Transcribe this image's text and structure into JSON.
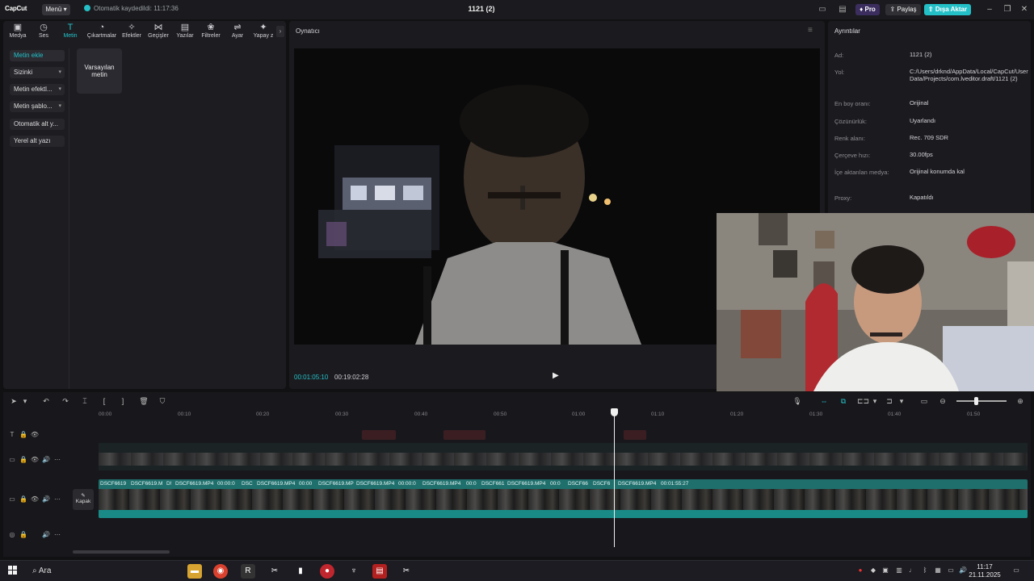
{
  "titlebar": {
    "logo": "CapCut",
    "menu_label": "Menü",
    "autosave": "Otomatik kaydedildi: 11:17:36",
    "title": "1121 (2)",
    "pro_label": "Pro",
    "share_label": "Paylaş",
    "export_label": "Dışa Aktar"
  },
  "toolbar": [
    {
      "label": "Medya",
      "icon": "media-icon"
    },
    {
      "label": "Ses",
      "icon": "audio-icon"
    },
    {
      "label": "Metin",
      "icon": "text-icon"
    },
    {
      "label": "Çıkartmalar",
      "icon": "sticker-icon"
    },
    {
      "label": "Efektler",
      "icon": "effects-icon"
    },
    {
      "label": "Geçişler",
      "icon": "transitions-icon"
    },
    {
      "label": "Yazılar",
      "icon": "captions-icon"
    },
    {
      "label": "Filtreler",
      "icon": "filters-icon"
    },
    {
      "label": "Ayar",
      "icon": "adjust-icon"
    },
    {
      "label": "Yapay z",
      "icon": "ai-icon"
    }
  ],
  "text_nav": {
    "items": [
      {
        "label": "Metin ekle"
      },
      {
        "label": "Sizinki"
      },
      {
        "label": "Metin efektl..."
      },
      {
        "label": "Metin şablo..."
      },
      {
        "label": "Otomatik alt y..."
      },
      {
        "label": "Yerel alt yazı"
      }
    ],
    "default_card": "Varsayılan metin"
  },
  "player": {
    "title": "Oynatıcı",
    "time_current": "00:01:05:10",
    "time_total": "00:19:02:28"
  },
  "details": {
    "title": "Ayrıntılar",
    "rows": [
      {
        "label": "Ad:",
        "value": "1121 (2)"
      },
      {
        "label": "Yol:",
        "value": "C:/Users/drknd/AppData/Local/CapCut/User Data/Projects/com.lveditor.draft/1121 (2)"
      },
      {
        "label": "En boy oranı:",
        "value": "Orijinal"
      },
      {
        "label": "Çözünürlük:",
        "value": "Uyarlandı"
      },
      {
        "label": "Renk alanı:",
        "value": "Rec. 709 SDR"
      },
      {
        "label": "Çerçeve hızı:",
        "value": "30.00fps"
      },
      {
        "label": "İçe aktarılan medya:",
        "value": "Orijinal konumda kal"
      },
      {
        "label": "Proxy:",
        "value": "Kapatıldı"
      }
    ]
  },
  "timeline": {
    "ruler": [
      "00:00",
      "00:10",
      "00:20",
      "00:30",
      "00:40",
      "00:50",
      "01:00",
      "01:10",
      "01:20",
      "01:30",
      "01:40",
      "01:50"
    ],
    "cover_label": "Kapak",
    "main_clips": [
      {
        "label": "DSCF6619"
      },
      {
        "label": "DSCF6619.M"
      },
      {
        "label": "D!"
      },
      {
        "label": "DSCF6619.MP4"
      },
      {
        "label": "00:00:0"
      },
      {
        "label": "DSC"
      },
      {
        "label": "DSCF6619.MP4"
      },
      {
        "label": "00:00"
      },
      {
        "label": "DSCF6619.MP"
      },
      {
        "label": "DSCF6619.MP4"
      },
      {
        "label": "00:00:0"
      },
      {
        "label": "DSCF6619.MP4"
      },
      {
        "label": "00:0"
      },
      {
        "label": "DSCF661"
      },
      {
        "label": "DSCF6619.MP4"
      },
      {
        "label": "00:0"
      },
      {
        "label": "DSCF66"
      },
      {
        "label": "DSCF6"
      },
      {
        "label": "DSCF6619.MP4"
      },
      {
        "label": "00:01:55:27"
      }
    ]
  },
  "taskbar": {
    "search_label": "Ara",
    "time": "11:17",
    "date": "21.11.2025"
  }
}
